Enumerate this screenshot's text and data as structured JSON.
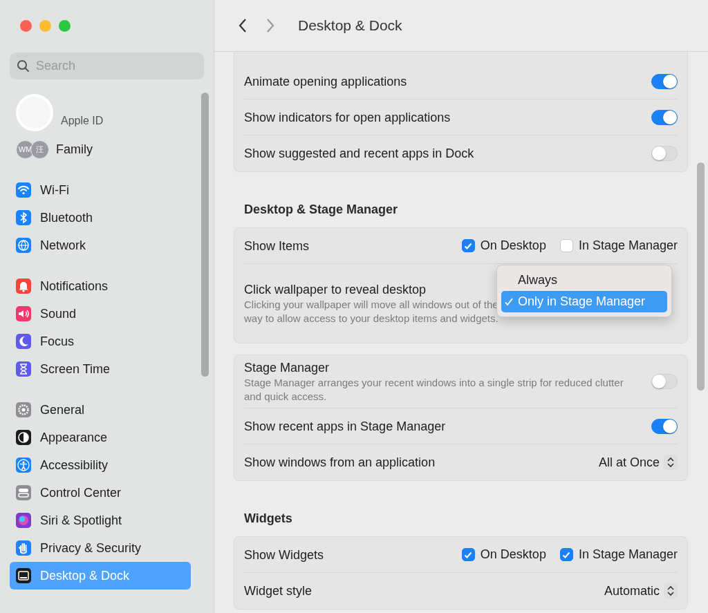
{
  "sidebar": {
    "search": {
      "placeholder": "Search"
    },
    "account": {
      "subtitle": "Apple ID"
    },
    "family": {
      "label": "Family",
      "badges": [
        "WM",
        "汪"
      ]
    },
    "groups": [
      [
        {
          "label": "Wi-Fi",
          "kind": "wifi",
          "color": "#1a84ff",
          "selected": false
        },
        {
          "label": "Bluetooth",
          "kind": "bluetooth",
          "color": "#1a84ff",
          "selected": false
        },
        {
          "label": "Network",
          "kind": "globe",
          "color": "#1a84ff",
          "selected": false
        }
      ],
      [
        {
          "label": "Notifications",
          "kind": "bell",
          "color": "#f5453d",
          "selected": false
        },
        {
          "label": "Sound",
          "kind": "speaker",
          "color": "#f0386b",
          "selected": false
        },
        {
          "label": "Focus",
          "kind": "moon",
          "color": "#5e5ce6",
          "selected": false
        },
        {
          "label": "Screen Time",
          "kind": "hourglass",
          "color": "#5e5ce6",
          "selected": false
        }
      ],
      [
        {
          "label": "General",
          "kind": "gear",
          "color": "#8e8e93",
          "selected": false
        },
        {
          "label": "Appearance",
          "kind": "contrast",
          "color": "#1c1c1e",
          "selected": false
        },
        {
          "label": "Accessibility",
          "kind": "person",
          "color": "#1a84ff",
          "selected": false
        },
        {
          "label": "Control Center",
          "kind": "switches",
          "color": "#8e8e93",
          "selected": false
        },
        {
          "label": "Siri & Spotlight",
          "kind": "orb",
          "color": "#7d3cc9",
          "selected": false
        },
        {
          "label": "Privacy & Security",
          "kind": "hand",
          "color": "#1a84ff",
          "selected": false
        },
        {
          "label": "Desktop & Dock",
          "kind": "dock",
          "color": "#1c1c1e",
          "selected": true
        }
      ]
    ]
  },
  "header": {
    "title": "Desktop & Dock"
  },
  "sections": [
    {
      "rows": [
        {
          "kind": "toggle",
          "label": "Animate opening applications",
          "on": true
        },
        {
          "kind": "toggle",
          "label": "Show indicators for open applications",
          "on": true
        },
        {
          "kind": "toggle",
          "label": "Show suggested and recent apps in Dock",
          "on": false
        }
      ]
    },
    {
      "heading": "Desktop & Stage Manager",
      "rows": [
        {
          "kind": "checks",
          "label": "Show Items",
          "checks": [
            {
              "label": "On Desktop",
              "checked": true
            },
            {
              "label": "In Stage Manager",
              "checked": false
            }
          ]
        },
        {
          "kind": "menu",
          "label": "Click wallpaper to reveal desktop",
          "description": "Clicking your wallpaper will move all windows out of the way to allow access to your desktop items and widgets.",
          "menu": [
            {
              "label": "Always",
              "selected": false
            },
            {
              "label": "Only in Stage Manager",
              "selected": true
            }
          ]
        }
      ]
    },
    {
      "rows": [
        {
          "kind": "toggle",
          "label": "Stage Manager",
          "description": "Stage Manager arranges your recent windows into a single strip for reduced clutter and quick access.",
          "on": false
        },
        {
          "kind": "toggle",
          "label": "Show recent apps in Stage Manager",
          "on": true
        },
        {
          "kind": "popup",
          "label": "Show windows from an application",
          "value": "All at Once"
        }
      ]
    },
    {
      "heading": "Widgets",
      "rows": [
        {
          "kind": "checks",
          "label": "Show Widgets",
          "checks": [
            {
              "label": "On Desktop",
              "checked": true
            },
            {
              "label": "In Stage Manager",
              "checked": true
            }
          ]
        },
        {
          "kind": "popup",
          "label": "Widget style",
          "value": "Automatic"
        }
      ]
    }
  ]
}
